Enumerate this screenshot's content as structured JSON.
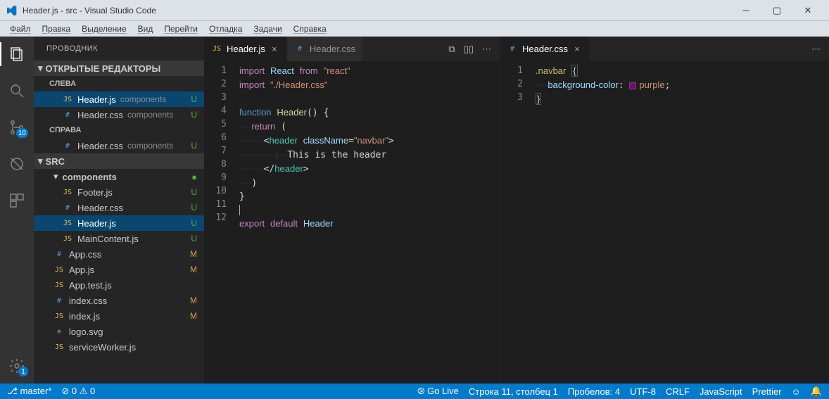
{
  "title": "Header.js - src - Visual Studio Code",
  "menu": [
    "Файл",
    "Правка",
    "Выделение",
    "Вид",
    "Перейти",
    "Отладка",
    "Задачи",
    "Справка"
  ],
  "activity_badges": {
    "scm": "10",
    "settings": "1"
  },
  "sidebar": {
    "title": "ПРОВОДНИК",
    "open_editors": "ОТКРЫТЫЕ РЕДАКТОРЫ",
    "left_group": "СЛЕВА",
    "right_group": "СПРАВА",
    "src_section": "SRC",
    "components_folder": "components",
    "open": [
      {
        "name": "Header.js",
        "dim": "components",
        "status": "U",
        "icon": "js"
      },
      {
        "name": "Header.css",
        "dim": "components",
        "status": "U",
        "icon": "css"
      }
    ],
    "open_right": [
      {
        "name": "Header.css",
        "dim": "components",
        "status": "U",
        "icon": "css"
      }
    ],
    "components": [
      {
        "name": "Footer.js",
        "status": "U",
        "icon": "js"
      },
      {
        "name": "Header.css",
        "status": "U",
        "icon": "css"
      },
      {
        "name": "Header.js",
        "status": "U",
        "icon": "js",
        "selected": true
      },
      {
        "name": "MainContent.js",
        "status": "U",
        "icon": "js"
      }
    ],
    "root": [
      {
        "name": "App.css",
        "status": "M",
        "icon": "css"
      },
      {
        "name": "App.js",
        "status": "M",
        "icon": "js"
      },
      {
        "name": "App.test.js",
        "status": "",
        "icon": "js"
      },
      {
        "name": "index.css",
        "status": "M",
        "icon": "css"
      },
      {
        "name": "index.js",
        "status": "M",
        "icon": "js"
      },
      {
        "name": "logo.svg",
        "status": "",
        "icon": "svg"
      },
      {
        "name": "serviceWorker.js",
        "status": "",
        "icon": "js"
      }
    ]
  },
  "tabs": {
    "left": [
      {
        "label": "Header.js",
        "icon": "js",
        "active": true
      },
      {
        "label": "Header.css",
        "icon": "css",
        "active": false
      }
    ],
    "right": [
      {
        "label": "Header.css",
        "icon": "css",
        "active": true
      }
    ]
  },
  "editor_left": {
    "lines": [
      "import React from \"react\"",
      "import \"./Header.css\"",
      "",
      "function Header() {",
      "    return (",
      "        <header className=\"navbar\">",
      "            This is the header",
      "        </header>",
      "    )",
      "}",
      "",
      "export default Header"
    ]
  },
  "editor_right": {
    "lines": [
      ".navbar {",
      "    background-color: purple;",
      "}"
    ]
  },
  "status": {
    "branch": "master*",
    "errors": "0",
    "warnings": "0",
    "golive": "Go Live",
    "position": "Строка 11, столбец 1",
    "spaces": "Пробелов: 4",
    "encoding": "UTF-8",
    "eol": "CRLF",
    "lang": "JavaScript",
    "prettier": "Prettier"
  }
}
